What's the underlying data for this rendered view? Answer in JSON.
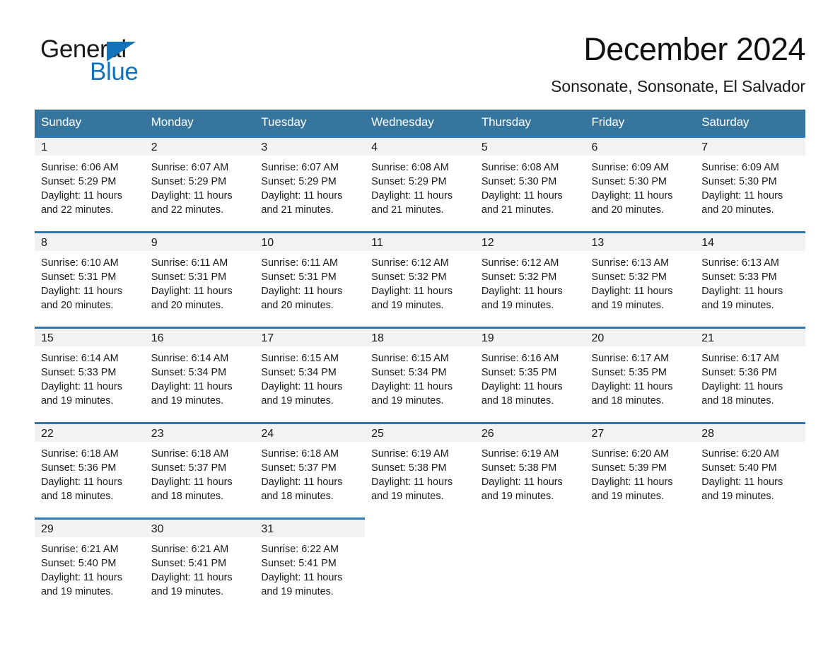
{
  "brand": {
    "name_part1": "General",
    "name_part2": "Blue",
    "accent_color": "#1272ba"
  },
  "header": {
    "title": "December 2024",
    "location": "Sonsonate, Sonsonate, El Salvador"
  },
  "calendar": {
    "header_bg": "#36769e",
    "row_border_color": "#2f77b3",
    "daynum_band_bg": "#f2f2f2",
    "weekdays": [
      "Sunday",
      "Monday",
      "Tuesday",
      "Wednesday",
      "Thursday",
      "Friday",
      "Saturday"
    ],
    "weeks": [
      [
        {
          "day": "1",
          "sunrise": "Sunrise: 6:06 AM",
          "sunset": "Sunset: 5:29 PM",
          "daylight": "Daylight: 11 hours and 22 minutes."
        },
        {
          "day": "2",
          "sunrise": "Sunrise: 6:07 AM",
          "sunset": "Sunset: 5:29 PM",
          "daylight": "Daylight: 11 hours and 22 minutes."
        },
        {
          "day": "3",
          "sunrise": "Sunrise: 6:07 AM",
          "sunset": "Sunset: 5:29 PM",
          "daylight": "Daylight: 11 hours and 21 minutes."
        },
        {
          "day": "4",
          "sunrise": "Sunrise: 6:08 AM",
          "sunset": "Sunset: 5:29 PM",
          "daylight": "Daylight: 11 hours and 21 minutes."
        },
        {
          "day": "5",
          "sunrise": "Sunrise: 6:08 AM",
          "sunset": "Sunset: 5:30 PM",
          "daylight": "Daylight: 11 hours and 21 minutes."
        },
        {
          "day": "6",
          "sunrise": "Sunrise: 6:09 AM",
          "sunset": "Sunset: 5:30 PM",
          "daylight": "Daylight: 11 hours and 20 minutes."
        },
        {
          "day": "7",
          "sunrise": "Sunrise: 6:09 AM",
          "sunset": "Sunset: 5:30 PM",
          "daylight": "Daylight: 11 hours and 20 minutes."
        }
      ],
      [
        {
          "day": "8",
          "sunrise": "Sunrise: 6:10 AM",
          "sunset": "Sunset: 5:31 PM",
          "daylight": "Daylight: 11 hours and 20 minutes."
        },
        {
          "day": "9",
          "sunrise": "Sunrise: 6:11 AM",
          "sunset": "Sunset: 5:31 PM",
          "daylight": "Daylight: 11 hours and 20 minutes."
        },
        {
          "day": "10",
          "sunrise": "Sunrise: 6:11 AM",
          "sunset": "Sunset: 5:31 PM",
          "daylight": "Daylight: 11 hours and 20 minutes."
        },
        {
          "day": "11",
          "sunrise": "Sunrise: 6:12 AM",
          "sunset": "Sunset: 5:32 PM",
          "daylight": "Daylight: 11 hours and 19 minutes."
        },
        {
          "day": "12",
          "sunrise": "Sunrise: 6:12 AM",
          "sunset": "Sunset: 5:32 PM",
          "daylight": "Daylight: 11 hours and 19 minutes."
        },
        {
          "day": "13",
          "sunrise": "Sunrise: 6:13 AM",
          "sunset": "Sunset: 5:32 PM",
          "daylight": "Daylight: 11 hours and 19 minutes."
        },
        {
          "day": "14",
          "sunrise": "Sunrise: 6:13 AM",
          "sunset": "Sunset: 5:33 PM",
          "daylight": "Daylight: 11 hours and 19 minutes."
        }
      ],
      [
        {
          "day": "15",
          "sunrise": "Sunrise: 6:14 AM",
          "sunset": "Sunset: 5:33 PM",
          "daylight": "Daylight: 11 hours and 19 minutes."
        },
        {
          "day": "16",
          "sunrise": "Sunrise: 6:14 AM",
          "sunset": "Sunset: 5:34 PM",
          "daylight": "Daylight: 11 hours and 19 minutes."
        },
        {
          "day": "17",
          "sunrise": "Sunrise: 6:15 AM",
          "sunset": "Sunset: 5:34 PM",
          "daylight": "Daylight: 11 hours and 19 minutes."
        },
        {
          "day": "18",
          "sunrise": "Sunrise: 6:15 AM",
          "sunset": "Sunset: 5:34 PM",
          "daylight": "Daylight: 11 hours and 19 minutes."
        },
        {
          "day": "19",
          "sunrise": "Sunrise: 6:16 AM",
          "sunset": "Sunset: 5:35 PM",
          "daylight": "Daylight: 11 hours and 18 minutes."
        },
        {
          "day": "20",
          "sunrise": "Sunrise: 6:17 AM",
          "sunset": "Sunset: 5:35 PM",
          "daylight": "Daylight: 11 hours and 18 minutes."
        },
        {
          "day": "21",
          "sunrise": "Sunrise: 6:17 AM",
          "sunset": "Sunset: 5:36 PM",
          "daylight": "Daylight: 11 hours and 18 minutes."
        }
      ],
      [
        {
          "day": "22",
          "sunrise": "Sunrise: 6:18 AM",
          "sunset": "Sunset: 5:36 PM",
          "daylight": "Daylight: 11 hours and 18 minutes."
        },
        {
          "day": "23",
          "sunrise": "Sunrise: 6:18 AM",
          "sunset": "Sunset: 5:37 PM",
          "daylight": "Daylight: 11 hours and 18 minutes."
        },
        {
          "day": "24",
          "sunrise": "Sunrise: 6:18 AM",
          "sunset": "Sunset: 5:37 PM",
          "daylight": "Daylight: 11 hours and 18 minutes."
        },
        {
          "day": "25",
          "sunrise": "Sunrise: 6:19 AM",
          "sunset": "Sunset: 5:38 PM",
          "daylight": "Daylight: 11 hours and 19 minutes."
        },
        {
          "day": "26",
          "sunrise": "Sunrise: 6:19 AM",
          "sunset": "Sunset: 5:38 PM",
          "daylight": "Daylight: 11 hours and 19 minutes."
        },
        {
          "day": "27",
          "sunrise": "Sunrise: 6:20 AM",
          "sunset": "Sunset: 5:39 PM",
          "daylight": "Daylight: 11 hours and 19 minutes."
        },
        {
          "day": "28",
          "sunrise": "Sunrise: 6:20 AM",
          "sunset": "Sunset: 5:40 PM",
          "daylight": "Daylight: 11 hours and 19 minutes."
        }
      ],
      [
        {
          "day": "29",
          "sunrise": "Sunrise: 6:21 AM",
          "sunset": "Sunset: 5:40 PM",
          "daylight": "Daylight: 11 hours and 19 minutes."
        },
        {
          "day": "30",
          "sunrise": "Sunrise: 6:21 AM",
          "sunset": "Sunset: 5:41 PM",
          "daylight": "Daylight: 11 hours and 19 minutes."
        },
        {
          "day": "31",
          "sunrise": "Sunrise: 6:22 AM",
          "sunset": "Sunset: 5:41 PM",
          "daylight": "Daylight: 11 hours and 19 minutes."
        },
        {
          "day": "",
          "sunrise": "",
          "sunset": "",
          "daylight": ""
        },
        {
          "day": "",
          "sunrise": "",
          "sunset": "",
          "daylight": ""
        },
        {
          "day": "",
          "sunrise": "",
          "sunset": "",
          "daylight": ""
        },
        {
          "day": "",
          "sunrise": "",
          "sunset": "",
          "daylight": ""
        }
      ]
    ]
  }
}
